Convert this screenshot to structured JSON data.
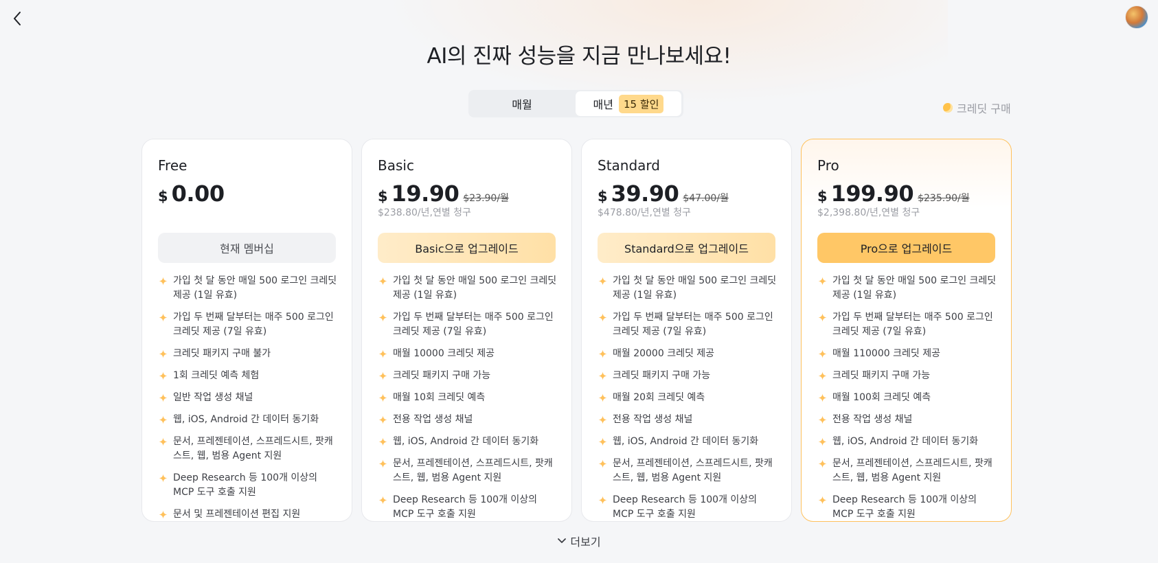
{
  "header": {
    "title": "AI의 진짜 성능을 지금 만나보세요!",
    "back_icon": "chevron-left-icon",
    "avatar_icon": "avatar"
  },
  "billing_toggle": {
    "monthly_label": "매월",
    "yearly_label": "매년",
    "yearly_badge": "15 할인",
    "selected": "yearly"
  },
  "credit_purchase": {
    "label": "크레딧 구매",
    "icon": "coin-icon"
  },
  "colors": {
    "accent": "#ffc766",
    "pro_border": "#ffc15c",
    "spark": "#ffc15c"
  },
  "plans": [
    {
      "name": "Free",
      "currency": "$",
      "price": "0.00",
      "original_price": "",
      "annual_note": "",
      "cta": "현재 멤버십",
      "features": [
        "가입 첫 달 동안 매일 500 로그인 크레딧 제공 (1일 유효)",
        "가입 두 번째 달부터는 매주 500 로그인 크레딧 제공 (7일 유효)",
        "크레딧 패키지 구매 불가",
        "1회 크레딧 예측 체험",
        "일반 작업 생성 채널",
        "웹, iOS, Android 간 데이터 동기화",
        "문서, 프레젠테이션, 스프레드시트, 팟캐스트, 웹, 범용 Agent 지원",
        "Deep Research 등 100개 이상의 MCP 도구 호출 지원",
        "문서 및 프레젠테이션 편집 지원"
      ]
    },
    {
      "name": "Basic",
      "currency": "$",
      "price": "19.90",
      "original_price": "$23.90/월",
      "annual_note": "$238.80/년,연별 청구",
      "cta": "Basic으로 업그레이드",
      "features": [
        "가입 첫 달 동안 매일 500 로그인 크레딧 제공 (1일 유효)",
        "가입 두 번째 달부터는 매주 500 로그인 크레딧 제공 (7일 유효)",
        "매월 10000 크레딧 제공",
        "크레딧 패키지 구매 가능",
        "매월 10회 크레딧 예측",
        "전용 작업 생성 채널",
        "웹, iOS, Android 간 데이터 동기화",
        "문서, 프레젠테이션, 스프레드시트, 팟캐스트, 웹, 범용 Agent 지원",
        "Deep Research 등 100개 이상의 MCP 도구 호출 지원"
      ]
    },
    {
      "name": "Standard",
      "currency": "$",
      "price": "39.90",
      "original_price": "$47.00/월",
      "annual_note": "$478.80/년,연별 청구",
      "cta": "Standard으로 업그레이드",
      "features": [
        "가입 첫 달 동안 매일 500 로그인 크레딧 제공 (1일 유효)",
        "가입 두 번째 달부터는 매주 500 로그인 크레딧 제공 (7일 유효)",
        "매월 20000 크레딧 제공",
        "크레딧 패키지 구매 가능",
        "매월 20회 크레딧 예측",
        "전용 작업 생성 채널",
        "웹, iOS, Android 간 데이터 동기화",
        "문서, 프레젠테이션, 스프레드시트, 팟캐스트, 웹, 범용 Agent 지원",
        "Deep Research 등 100개 이상의 MCP 도구 호출 지원"
      ]
    },
    {
      "name": "Pro",
      "currency": "$",
      "price": "199.90",
      "original_price": "$235.90/월",
      "annual_note": "$2,398.80/년,연별 청구",
      "cta": "Pro으로 업그레이드",
      "features": [
        "가입 첫 달 동안 매일 500 로그인 크레딧 제공 (1일 유효)",
        "가입 두 번째 달부터는 매주 500 로그인 크레딧 제공 (7일 유효)",
        "매월 110000 크레딧 제공",
        "크레딧 패키지 구매 가능",
        "매월 100회 크레딧 예측",
        "전용 작업 생성 채널",
        "웹, iOS, Android 간 데이터 동기화",
        "문서, 프레젠테이션, 스프레드시트, 팟캐스트, 웹, 범용 Agent 지원",
        "Deep Research 등 100개 이상의 MCP 도구 호출 지원"
      ]
    }
  ],
  "footer": {
    "more_label": "더보기",
    "more_icon": "chevron-down-icon"
  }
}
